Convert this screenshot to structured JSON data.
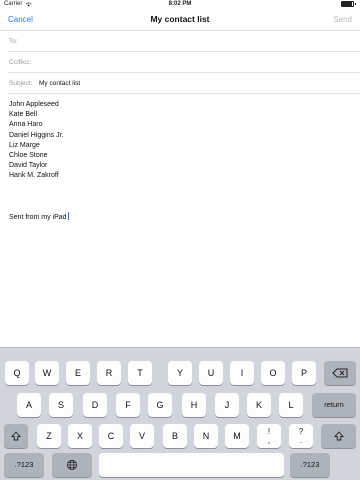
{
  "status_bar": {
    "carrier": "Carrier",
    "time": "8:02 PM"
  },
  "nav": {
    "cancel": "Cancel",
    "title": "My contact list",
    "send": "Send"
  },
  "fields": {
    "to_label": "To:",
    "ccbcc_label": "Cc/Bcc:",
    "subject_label": "Subject:",
    "subject_value": "My contact list"
  },
  "body": {
    "lines": [
      "John Appleseed",
      "Kate Bell",
      "Anna Haro",
      "Daniel Higgins Jr.",
      "Liz Marge",
      "Chloe Stone",
      "David Taylor",
      "Hank M. Zakroff"
    ],
    "signature": "Sent from my iPad"
  },
  "keyboard": {
    "row1": [
      "Q",
      "W",
      "E",
      "R",
      "T",
      "Y",
      "U",
      "I",
      "O",
      "P"
    ],
    "row2": [
      "A",
      "S",
      "D",
      "F",
      "G",
      "H",
      "J",
      "K",
      "L"
    ],
    "row3": [
      "Z",
      "X",
      "C",
      "V",
      "B",
      "N",
      "M",
      "!\n,",
      "?\n."
    ],
    "return_label": "return",
    "numbers_label": ".?123",
    "icons": {
      "backspace": "backspace-icon",
      "shift": "shift-icon",
      "globe": "globe-icon"
    }
  }
}
